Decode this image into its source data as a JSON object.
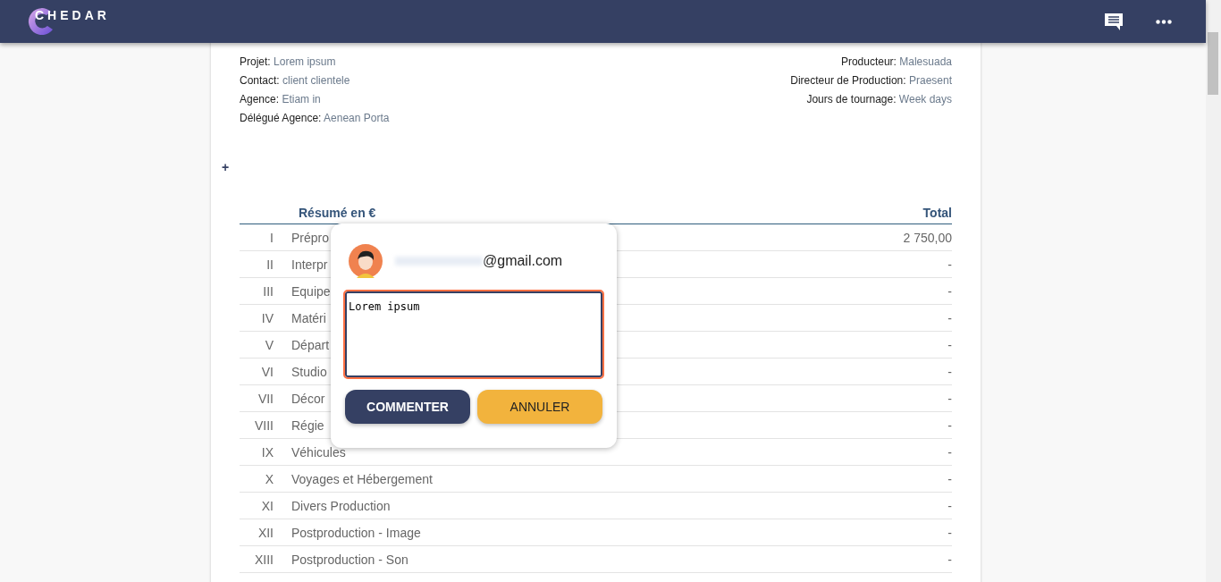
{
  "header": {
    "logo": "CHEDAR"
  },
  "project_info": {
    "left": [
      {
        "label": "Projet:",
        "value": "Lorem ipsum"
      },
      {
        "label": "Contact:",
        "value": "client clientele"
      },
      {
        "label": "Agence:",
        "value": "Etiam in"
      },
      {
        "label": "Délégué Agence:",
        "value": "Aenean Porta"
      }
    ],
    "right": [
      {
        "label": "Producteur:",
        "value": "Malesuada"
      },
      {
        "label": "Directeur de Production:",
        "value": "Praesent"
      },
      {
        "label": "Jours de tournage:",
        "value": "Week days"
      }
    ]
  },
  "add_button": "+",
  "summary_table": {
    "columns": [
      "Résumé en €",
      "Total"
    ],
    "rows": [
      {
        "number": "I",
        "label": "Prépro",
        "total": "2 750,00"
      },
      {
        "number": "II",
        "label": "Interpr",
        "total": "-"
      },
      {
        "number": "III",
        "label": "Equipe",
        "total": "-"
      },
      {
        "number": "IV",
        "label": "Matéri",
        "total": "-"
      },
      {
        "number": "V",
        "label": "Départ",
        "total": "-"
      },
      {
        "number": "VI",
        "label": "Studio",
        "total": "-"
      },
      {
        "number": "VII",
        "label": "Décor",
        "total": "-"
      },
      {
        "number": "VIII",
        "label": "Régie",
        "total": "-"
      },
      {
        "number": "IX",
        "label": "Véhicules",
        "total": "-"
      },
      {
        "number": "X",
        "label": "Voyages et Hébergement",
        "total": "-"
      },
      {
        "number": "XI",
        "label": "Divers Production",
        "total": "-"
      },
      {
        "number": "XII",
        "label": "Postproduction - Image",
        "total": "-"
      },
      {
        "number": "XIII",
        "label": "Postproduction - Son",
        "total": "-"
      }
    ]
  },
  "comment_popup": {
    "email": "@gmail.com",
    "comment": "Lorem ipsum",
    "buttons": [
      {
        "label": "COMMENTER",
        "kind": "primary"
      },
      {
        "label": "ANNULER",
        "kind": "secondary"
      }
    ]
  }
}
